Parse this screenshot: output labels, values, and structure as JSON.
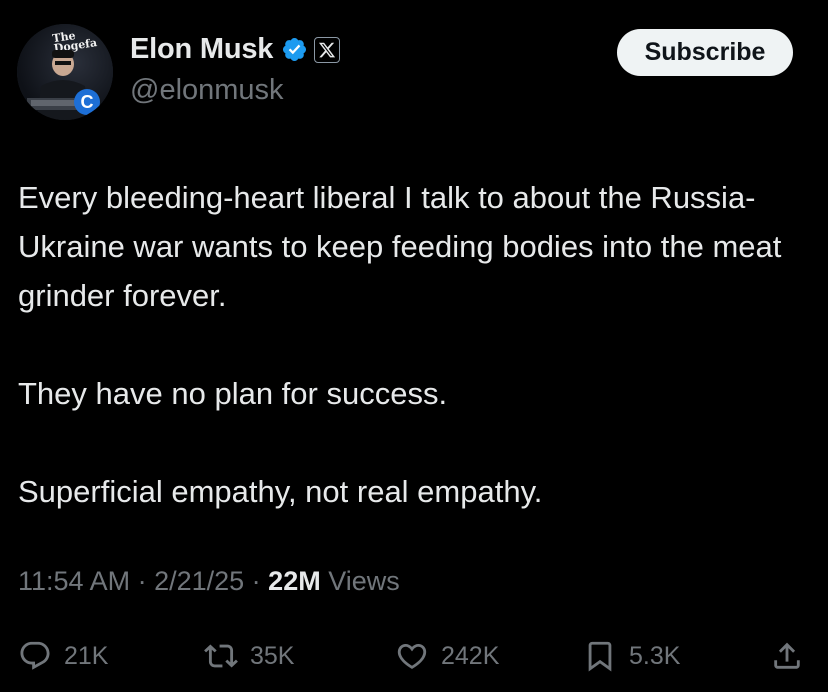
{
  "author": {
    "name": "Elon Musk",
    "handle": "@elonmusk",
    "avatar_logo_text": "The Dogefa"
  },
  "subscribe_label": "Subscribe",
  "tweet": {
    "paragraphs": [
      "Every bleeding-heart liberal I talk to about the Russia-Ukraine war wants to keep feeding bodies into the meat grinder forever.",
      "They have no plan for success.",
      "Superficial empathy, not real empathy."
    ]
  },
  "meta": {
    "time": "11:54 AM",
    "date": "2/21/25",
    "separator": " · ",
    "views_count": "22M",
    "views_label": "Views"
  },
  "actions": {
    "replies": "21K",
    "reposts": "35K",
    "likes": "242K",
    "bookmarks": "5.3K"
  },
  "colors": {
    "background": "#000000",
    "text": "#e7e9ea",
    "muted": "#71767b",
    "verified": "#1d9bf0"
  },
  "icons": [
    "verified-badge-icon",
    "x-logo-icon",
    "reply-icon",
    "repost-icon",
    "like-icon",
    "bookmark-icon",
    "share-icon"
  ]
}
